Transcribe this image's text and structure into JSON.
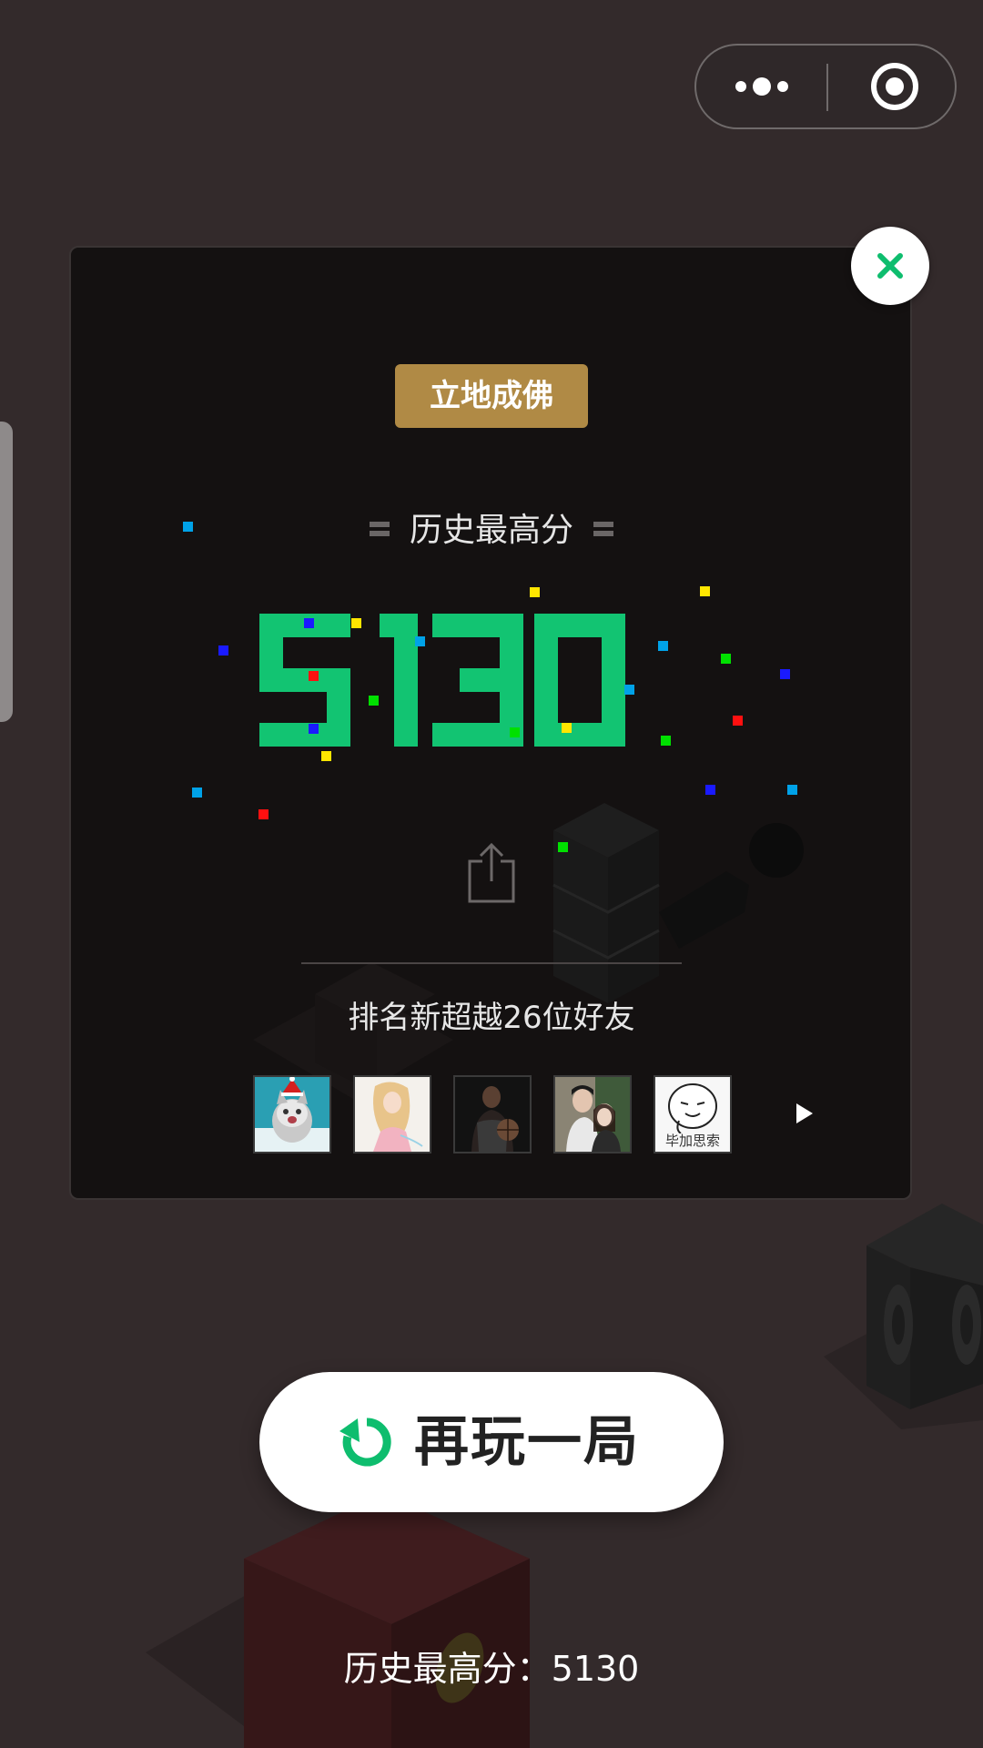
{
  "capsule": {
    "more_icon": "more-dots-icon",
    "exit_icon": "target-circle-icon"
  },
  "result": {
    "rank_title": "立地成佛",
    "best_score_label": "历史最高分",
    "score": "5130",
    "share_icon": "share-icon",
    "surpass_text": "排名新超越26位好友",
    "friends": [
      {
        "name": "friend-1",
        "avatar": "kitten-photo"
      },
      {
        "name": "friend-2",
        "avatar": "illustrated-girl"
      },
      {
        "name": "friend-3",
        "avatar": "basketball-player"
      },
      {
        "name": "friend-4",
        "avatar": "couple-photo"
      },
      {
        "name": "friend-5",
        "avatar": "meme-face",
        "caption": "毕加思索"
      }
    ]
  },
  "actions": {
    "replay_label": "再玩一局",
    "replay_icon": "refresh-icon",
    "close_icon": "close-icon"
  },
  "footer": {
    "best_text": "历史最高分：5130"
  },
  "colors": {
    "background": "#332a2b",
    "panel": "#141111",
    "score_green": "#12c472",
    "badge_gold": "#b08a45",
    "accent_green": "#0ebd6e"
  }
}
